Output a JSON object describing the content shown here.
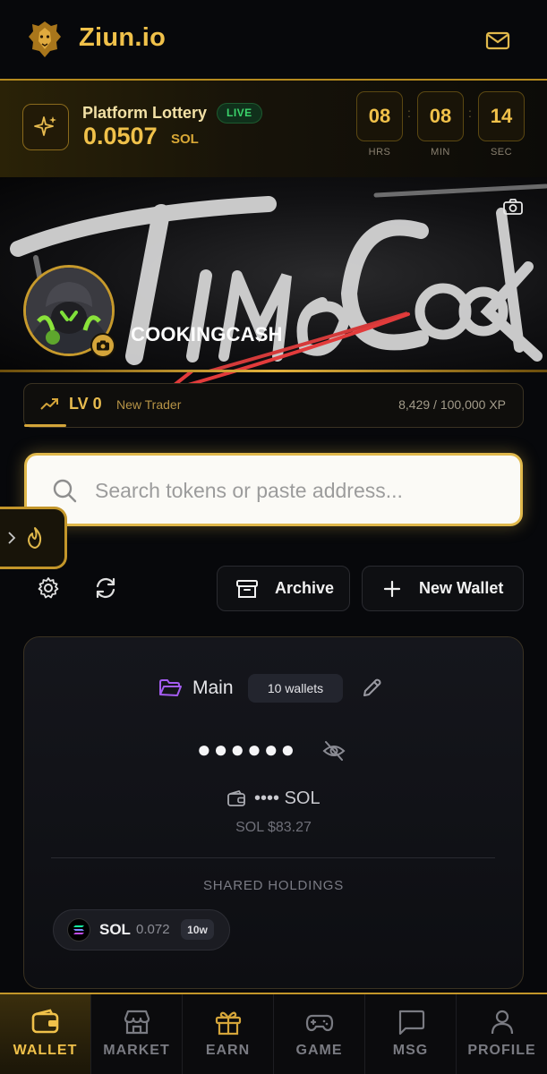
{
  "header": {
    "brand": "Ziun.io",
    "logo_icon": "lion-logo-icon",
    "mail_icon": "mail-icon"
  },
  "lottery": {
    "icon": "sparkle-icon",
    "title": "Platform Lottery",
    "live_label": "LIVE",
    "amount": "0.0507",
    "unit": "SOL",
    "timer": [
      {
        "value": "08",
        "label": "HRS"
      },
      {
        "value": "08",
        "label": "MIN"
      },
      {
        "value": "14",
        "label": "SEC"
      }
    ],
    "separator": ":"
  },
  "profile": {
    "username": "COOKINGCASH",
    "banner_camera_icon": "camera-icon",
    "avatar_camera_icon": "camera-icon"
  },
  "level": {
    "label": "LV 0",
    "rank": "New Trader",
    "xp": "8,429 / 100,000 XP",
    "progress_fraction": 0.084
  },
  "search": {
    "placeholder": "Search tokens or paste address..."
  },
  "toolbar": {
    "archive_label": "Archive",
    "new_wallet_label": "New Wallet"
  },
  "wallet": {
    "name": "Main",
    "count": "10 wallets",
    "balance_masked": "●●●●●●",
    "sol_balance": "•••• SOL",
    "sol_price": "SOL $83.27",
    "shared_label": "SHARED HOLDINGS",
    "holdings": [
      {
        "symbol": "SOL",
        "amount": "0.072",
        "badge": "10w"
      }
    ]
  },
  "nav": {
    "items": [
      {
        "label": "WALLET",
        "icon": "wallet-icon",
        "active": true
      },
      {
        "label": "MARKET",
        "icon": "store-icon",
        "active": false
      },
      {
        "label": "EARN",
        "icon": "gift-icon",
        "active": false
      },
      {
        "label": "GAME",
        "icon": "gamepad-icon",
        "active": false
      },
      {
        "label": "MSG",
        "icon": "message-icon",
        "active": false
      },
      {
        "label": "PROFILE",
        "icon": "user-icon",
        "active": false
      }
    ]
  },
  "colors": {
    "accent_gold": "#f0c14a",
    "live_green": "#3bd46b",
    "background": "#07080b"
  }
}
